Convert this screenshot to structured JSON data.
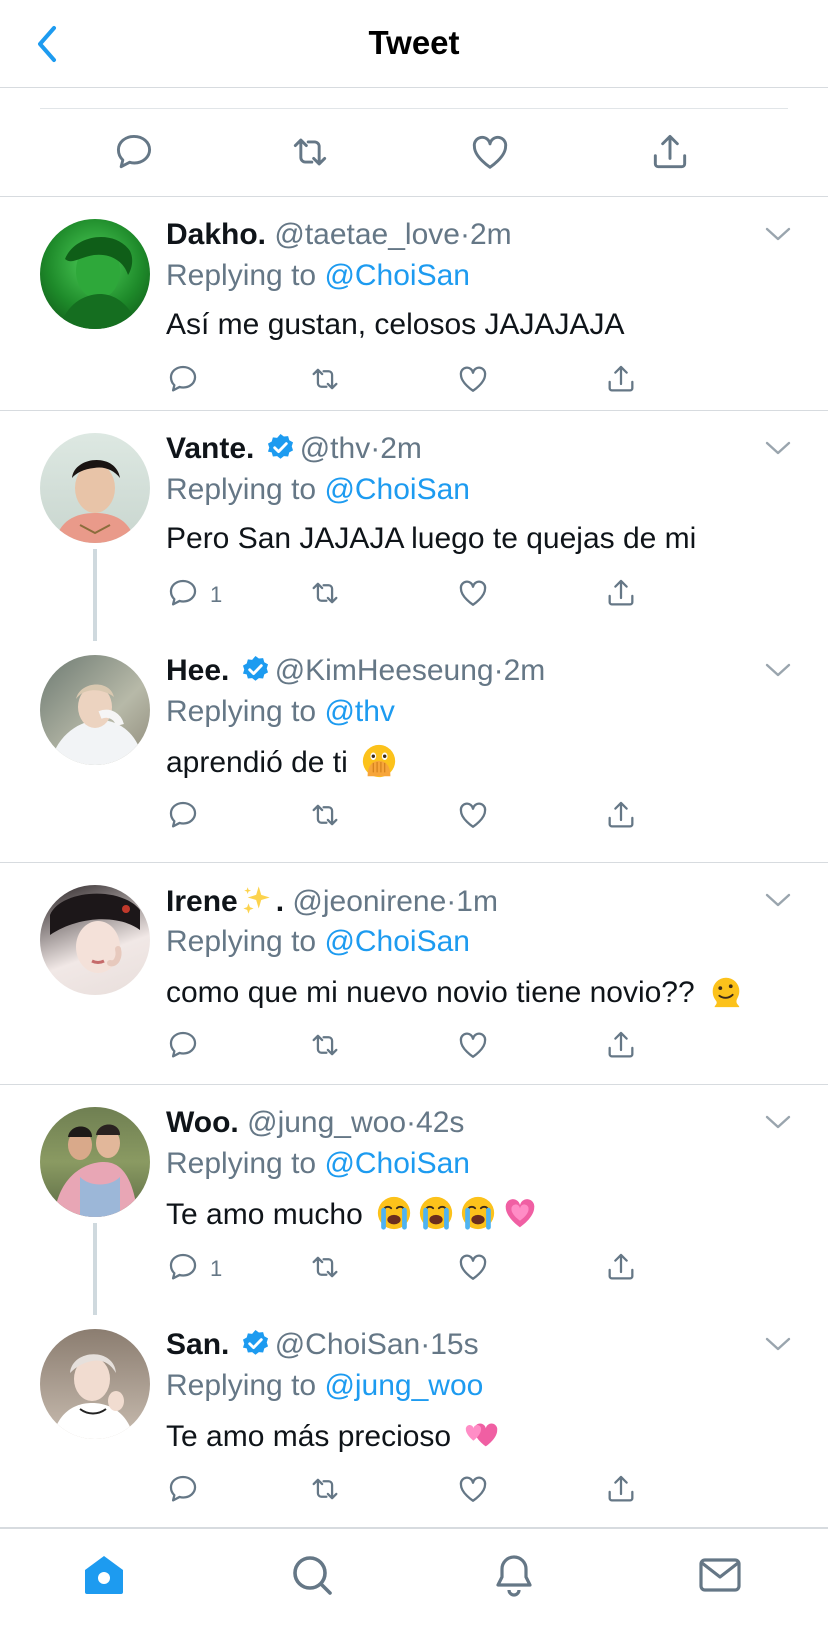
{
  "header": {
    "title": "Tweet",
    "back_icon": "chevron-left-icon"
  },
  "colors": {
    "accent": "#1d9bf0",
    "text": "#0f1419",
    "muted": "#657786",
    "divider": "#d7dbdf"
  },
  "main_actions": [
    "reply-icon",
    "retweet-icon",
    "like-icon",
    "share-icon"
  ],
  "replying_label": "Replying to",
  "tweets": [
    {
      "name": "Dakho.",
      "verified": false,
      "handle": "@taetae_love",
      "dot": "·",
      "time": "2m",
      "reply_to": "@ChoiSan",
      "text": "Así me gustan, celosos JAJAJAJA",
      "reply_count": ""
    },
    {
      "name": "Vante.",
      "verified": true,
      "handle": "@thv",
      "dot": "·",
      "time": "2m",
      "reply_to": "@ChoiSan",
      "text": "Pero San JAJAJA luego te quejas de mi",
      "reply_count": "1"
    },
    {
      "name": "Hee.",
      "verified": true,
      "handle": "@KimHeeseung",
      "dot": "·",
      "time": "2m",
      "reply_to": "@thv",
      "text": "aprendió de ti",
      "emojis": [
        "face-with-open-eyes-and-hand-over-mouth"
      ],
      "reply_count": ""
    },
    {
      "name": "Irene",
      "name_emoji": "sparkles",
      "name_suffix": ".",
      "verified": false,
      "handle": "@jeonirene",
      "dot": "·",
      "time": "1m",
      "reply_to": "@ChoiSan",
      "text": "como que mi nuevo novio tiene novio??",
      "emojis": [
        "melting-face"
      ],
      "reply_count": ""
    },
    {
      "name": "Woo.",
      "verified": false,
      "handle": "@jung_woo",
      "dot": "·",
      "time": "42s",
      "reply_to": "@ChoiSan",
      "text": "Te amo mucho",
      "emojis": [
        "loudly-crying-face",
        "loudly-crying-face",
        "loudly-crying-face",
        "growing-heart"
      ],
      "reply_count": "1"
    },
    {
      "name": "San.",
      "verified": true,
      "handle": "@ChoiSan",
      "dot": "·",
      "time": "15s",
      "reply_to": "@jung_woo",
      "text": "Te amo más precioso",
      "emojis": [
        "two-hearts"
      ],
      "reply_count": ""
    }
  ],
  "tabbar": [
    "home-icon",
    "search-icon",
    "notifications-icon",
    "messages-icon"
  ]
}
